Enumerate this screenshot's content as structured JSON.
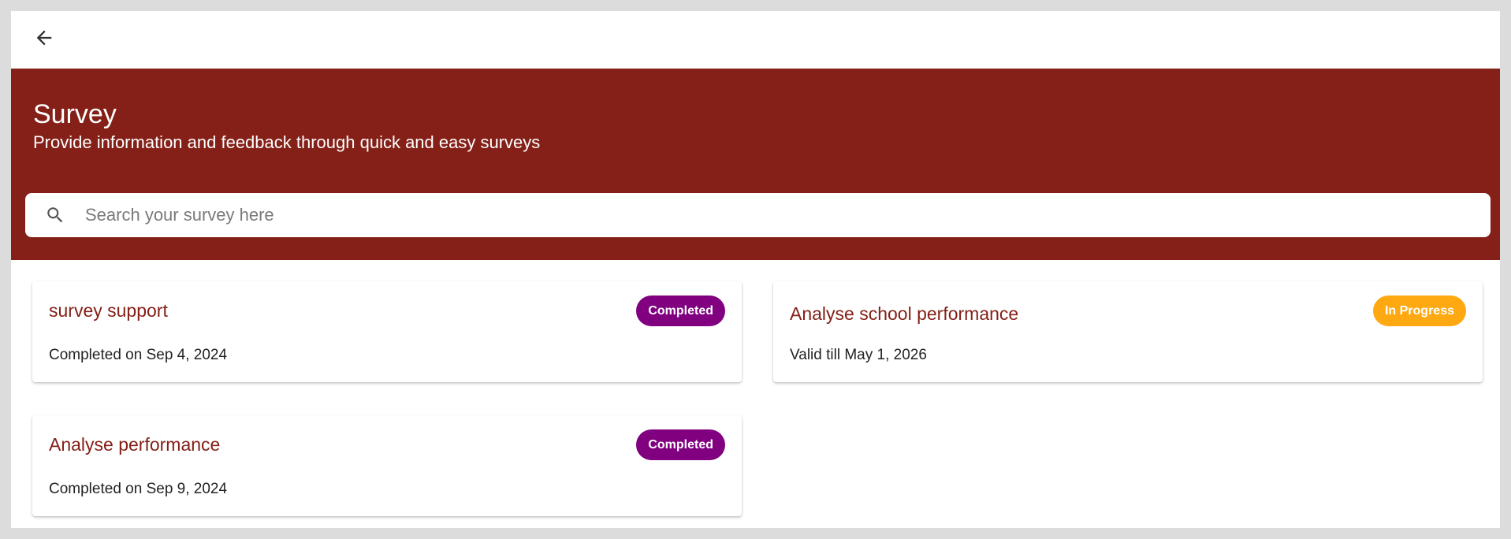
{
  "header": {
    "back_icon": "arrow-left-icon"
  },
  "hero": {
    "title": "Survey",
    "subtitle": "Provide information and feedback through quick and easy surveys",
    "background": "#842018"
  },
  "search": {
    "placeholder": "Search your survey here",
    "value": "",
    "icon": "search-icon"
  },
  "surveys": [
    {
      "title": "survey support",
      "detail": "Completed on Sep 4, 2024",
      "status": "Completed",
      "status_color": "#800080"
    },
    {
      "title": "Analyse school performance",
      "detail": "Valid till May 1, 2026",
      "status": "In Progress",
      "status_color": "#FFA912"
    },
    {
      "title": "Analyse performance",
      "detail": "Completed on Sep 9, 2024",
      "status": "Completed",
      "status_color": "#800080"
    }
  ]
}
